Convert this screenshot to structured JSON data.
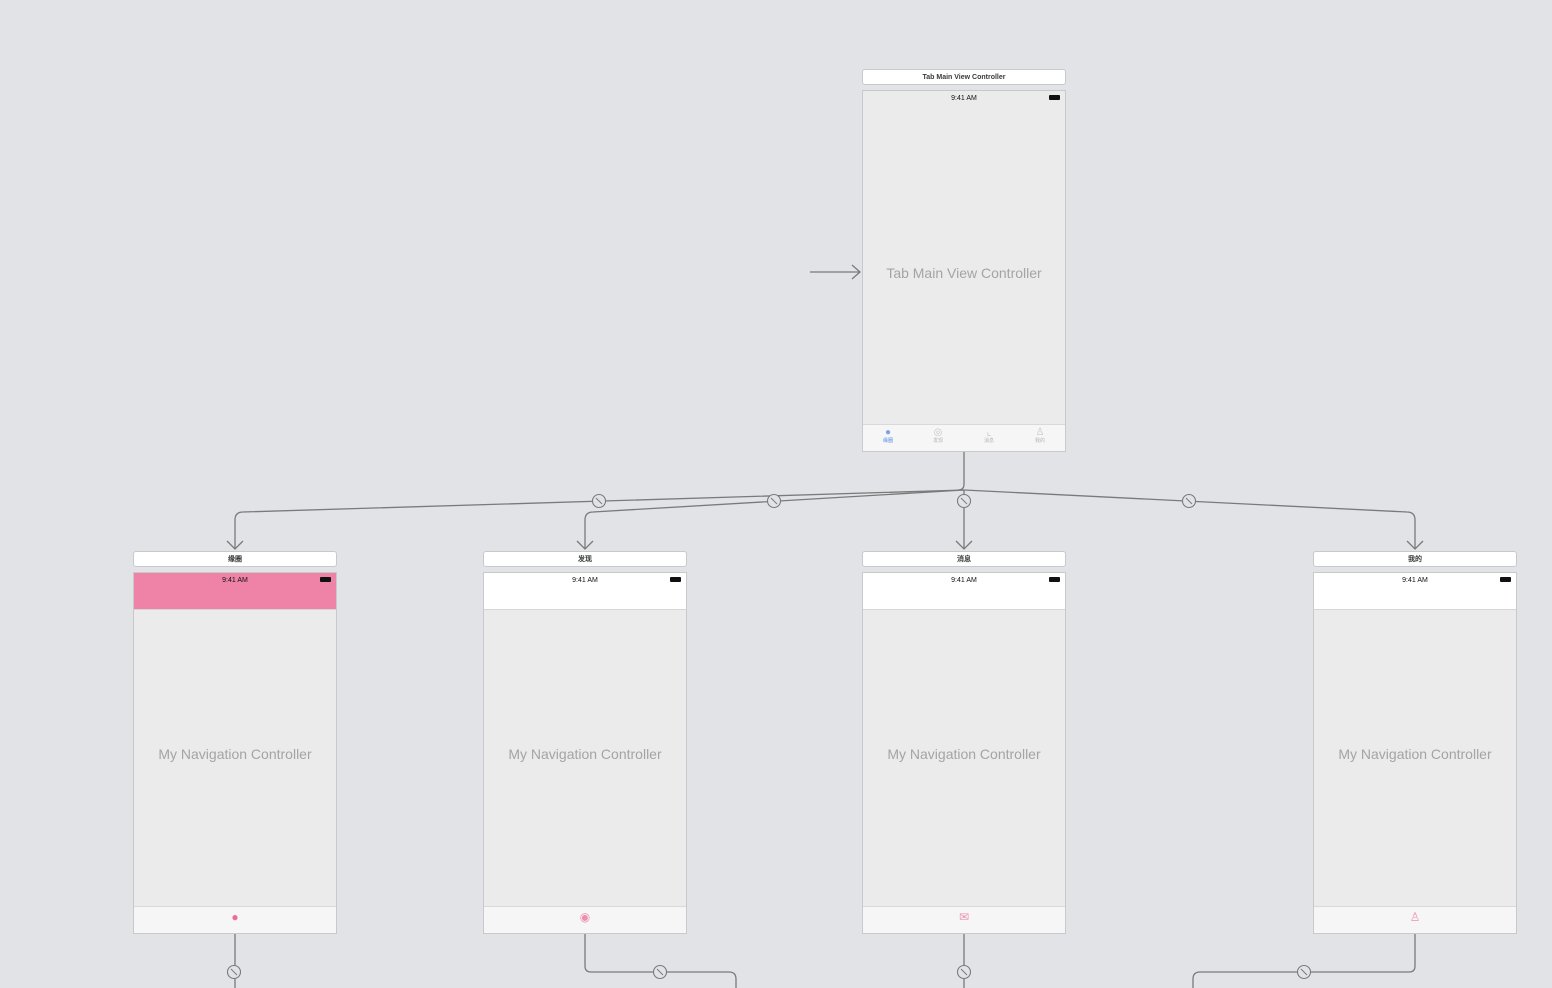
{
  "canvas": {
    "background": "#e2e3e7",
    "segue_color": "#7a7a7a"
  },
  "tab_main": {
    "scene_title": "Tab Main View Controller",
    "status_time": "9:41 AM",
    "center_label": "Tab Main View Controller",
    "tabs": [
      {
        "label": "缘圈",
        "icon": "circle-filled-icon",
        "glyph": "●",
        "active": true
      },
      {
        "label": "发现",
        "icon": "compass-icon",
        "glyph": "◎",
        "active": false
      },
      {
        "label": "消息",
        "icon": "chart-icon",
        "glyph": "⌞",
        "active": false
      },
      {
        "label": "我的",
        "icon": "person-icon",
        "glyph": "♙",
        "active": false
      }
    ]
  },
  "nav_controllers": [
    {
      "scene_title": "缘圈",
      "status_time": "9:41 AM",
      "center_label": "My Navigation Controller",
      "nav_bar_color": "#ee82a7",
      "tab_icon": "chat-bubble-icon",
      "tab_glyph": "●",
      "tab_icon_color": "#e96f99"
    },
    {
      "scene_title": "发现",
      "status_time": "9:41 AM",
      "center_label": "My Navigation Controller",
      "nav_bar_color": "#ffffff",
      "tab_icon": "compass-icon",
      "tab_glyph": "◉",
      "tab_icon_color": "#ee8fb0"
    },
    {
      "scene_title": "消息",
      "status_time": "9:41 AM",
      "center_label": "My Navigation Controller",
      "nav_bar_color": "#ffffff",
      "tab_icon": "envelope-icon",
      "tab_glyph": "✉",
      "tab_icon_color": "#ee8fb0"
    },
    {
      "scene_title": "我的",
      "status_time": "9:41 AM",
      "center_label": "My Navigation Controller",
      "nav_bar_color": "#ffffff",
      "tab_icon": "person-icon",
      "tab_glyph": "♙",
      "tab_icon_color": "#ee8fb0"
    }
  ]
}
